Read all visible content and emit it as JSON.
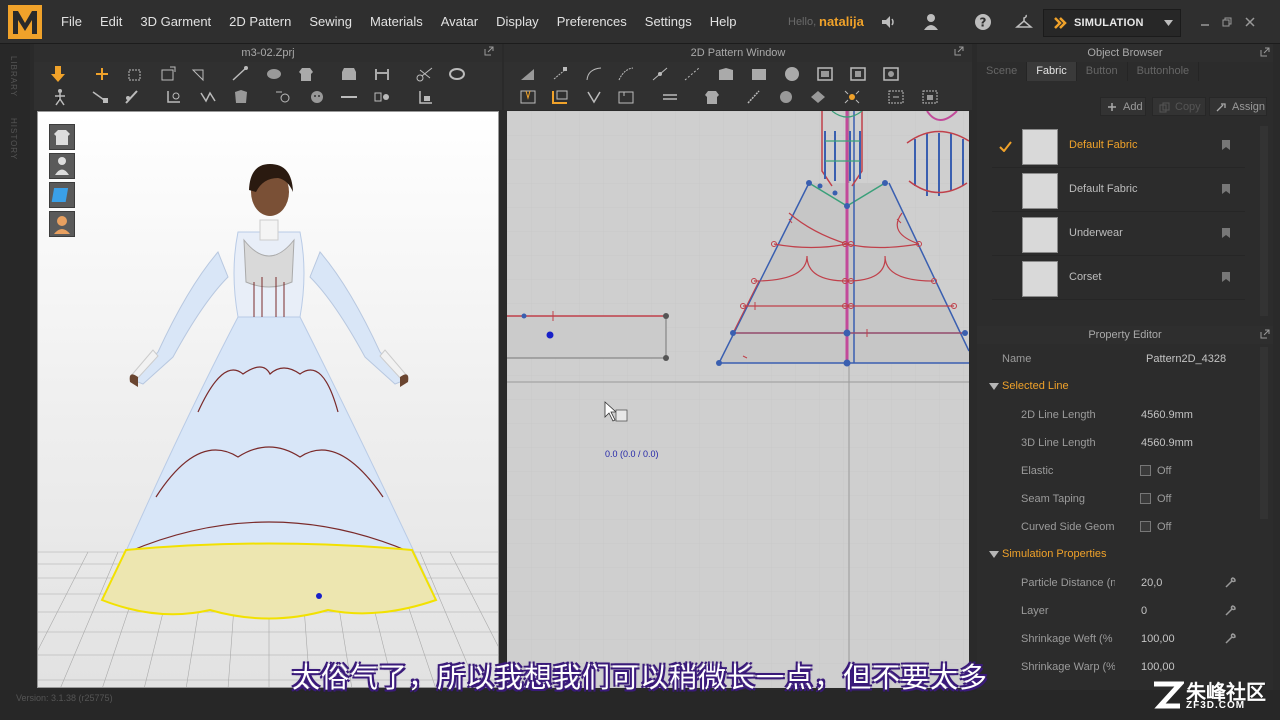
{
  "menubar": {
    "items": [
      "File",
      "Edit",
      "3D Garment",
      "2D Pattern",
      "Sewing",
      "Materials",
      "Avatar",
      "Display",
      "Preferences",
      "Settings",
      "Help"
    ],
    "hello": "Hello,",
    "username": "natalija",
    "simulation_label": "SIMULATION"
  },
  "left_rail": {
    "library": "LIBRARY",
    "history": "HISTORY"
  },
  "view3d": {
    "title": "m3-02.Zprj"
  },
  "view2d": {
    "title": "2D Pattern Window",
    "coord_readout": "0.0 (0.0 / 0.0)"
  },
  "object_browser": {
    "title": "Object Browser",
    "tabs": [
      "Scene",
      "Fabric",
      "Button",
      "Buttonhole"
    ],
    "active_tab": "Fabric",
    "add_label": "Add",
    "copy_label": "Copy",
    "assign_label": "Assign",
    "fabrics": [
      "Default Fabric",
      "Default Fabric",
      "Underwear",
      "Corset"
    ]
  },
  "property_editor": {
    "title": "Property Editor",
    "name_label": "Name",
    "name_value": "Pattern2D_4328",
    "selected_line_section": "Selected Line",
    "line_2d_label": "2D Line Length",
    "line_2d_value": "4560.9mm",
    "line_3d_label": "3D Line Length",
    "line_3d_value": "4560.9mm",
    "elastic_label": "Elastic",
    "elastic_value": "Off",
    "seam_taping_label": "Seam Taping",
    "seam_taping_value": "Off",
    "curved_side_label": "Curved Side Geome",
    "curved_side_value": "Off",
    "sim_section": "Simulation Properties",
    "particle_label": "Particle Distance (n",
    "particle_value": "20,0",
    "layer_label": "Layer",
    "layer_value": "0",
    "shrink_weft_label": "Shrinkage Weft (%",
    "shrink_weft_value": "100,00",
    "shrink_warp_label": "Shrinkage Warp (%",
    "shrink_warp_value": "100,00"
  },
  "status": {
    "version": "Version: 3.1.38 (r25775)"
  },
  "subtitle": "太俗气了，所以我想我们可以稍微长一点，但不要太多",
  "watermark": {
    "text": "朱峰社区",
    "url": "ZF3D.COM"
  },
  "colors": {
    "accent": "#f0a22a",
    "pattern_red": "#c0404a",
    "pattern_blue": "#3a5fb0",
    "selection_yellow": "#f2e100"
  }
}
